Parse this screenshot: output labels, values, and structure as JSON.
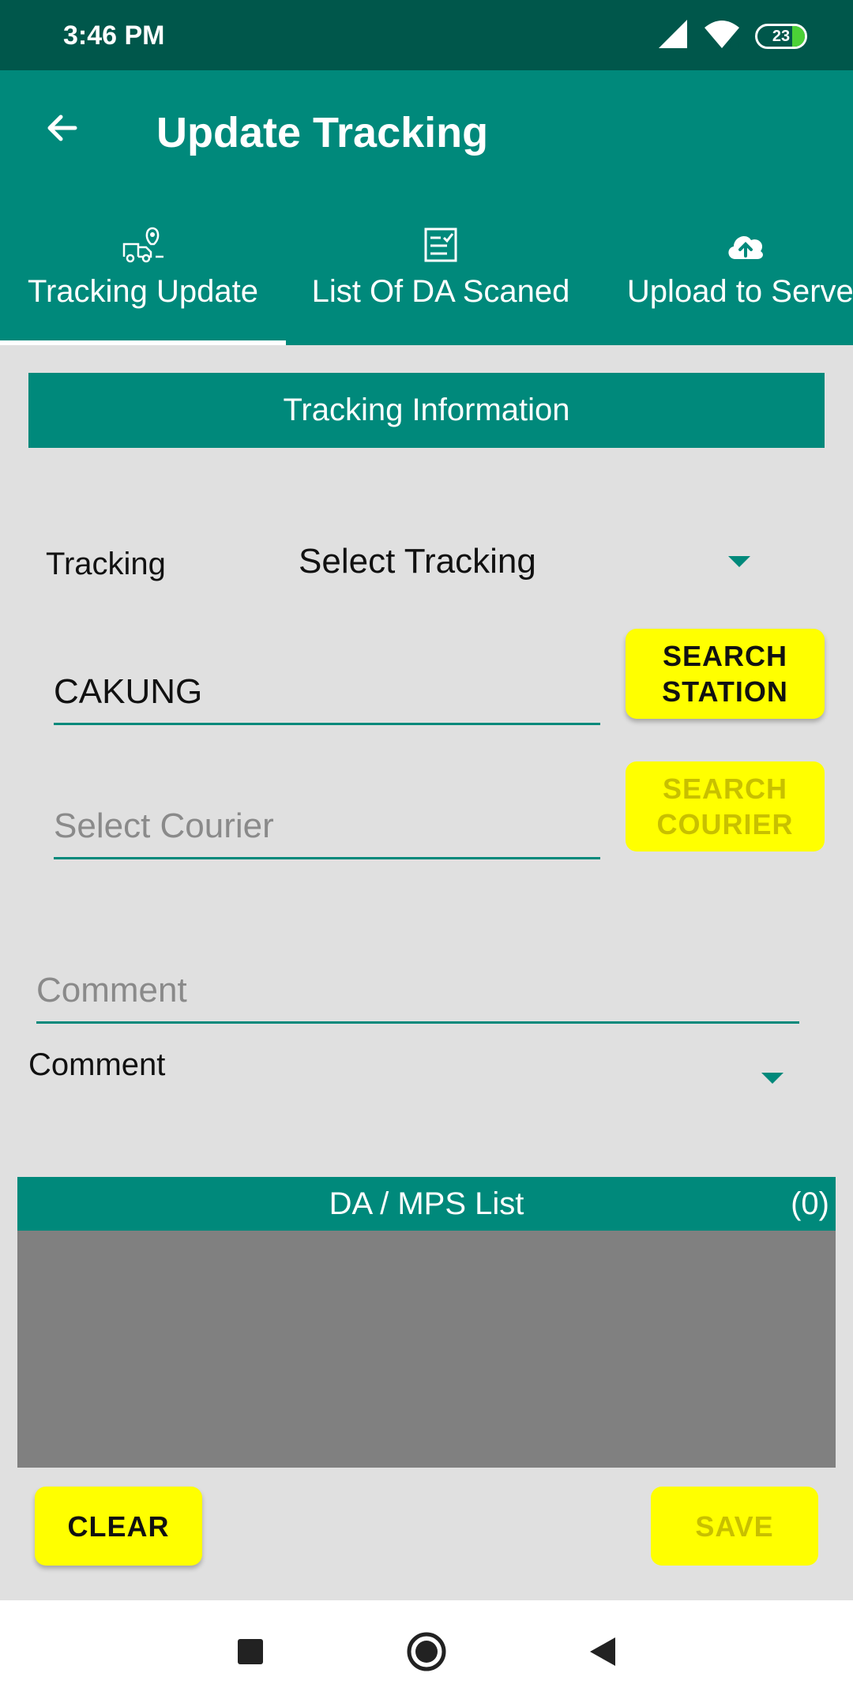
{
  "status_bar": {
    "time": "3:46 PM",
    "battery_level": "23",
    "icons": [
      "signal-icon",
      "wifi-icon",
      "battery-icon"
    ]
  },
  "app_bar": {
    "title": "Update Tracking",
    "back_icon": "arrow-left-icon"
  },
  "tabs": [
    {
      "label": "Tracking Update",
      "icon": "delivery-location-icon",
      "selected": true
    },
    {
      "label": "List Of DA Scaned",
      "icon": "checklist-icon",
      "selected": false
    },
    {
      "label": "Upload to Server",
      "icon": "cloud-upload-icon",
      "selected": false
    }
  ],
  "form": {
    "section_title": "Tracking Information",
    "tracking_label": "Tracking",
    "tracking_value": "Select Tracking",
    "station_value": "CAKUNG",
    "search_station_label": "SEARCH STATION",
    "courier_placeholder": "Select Courier",
    "search_courier_label": "SEARCH COURIER",
    "comment_placeholder": "Comment",
    "comment_label": "Comment"
  },
  "da_list": {
    "title": "DA / MPS List",
    "count": "(0)"
  },
  "actions": {
    "clear_label": "CLEAR",
    "save_label": "SAVE"
  },
  "colors": {
    "primary": "#00897b",
    "primary_dark": "#00574b",
    "accent_yellow": "#ffff00",
    "background": "#e0e0e0",
    "list_background": "#808080"
  }
}
